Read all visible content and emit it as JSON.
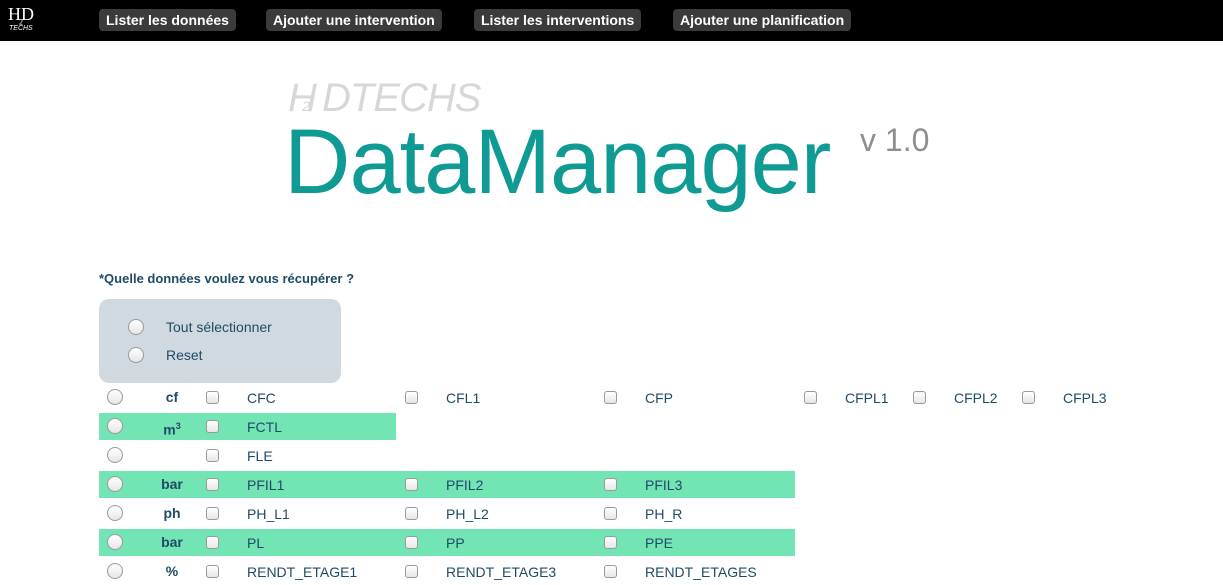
{
  "nav": {
    "brand_h": "H",
    "brand_2": "2",
    "brand_d": "D",
    "brand_techs": "TECHS",
    "buttons": [
      "Lister les données",
      "Ajouter une intervention",
      "Lister les interventions",
      "Ajouter une planification"
    ]
  },
  "logo": {
    "techs_h": "H",
    "techs_2": "2",
    "techs_text": "DTECHS",
    "title": "DataManager",
    "version": "v 1.0"
  },
  "form": {
    "question": "*Quelle données voulez vous récupérer ?",
    "select_all_label": "Tout sélectionner",
    "reset_label": "Reset"
  },
  "rows": [
    {
      "unit": "cf",
      "sup": "",
      "highlight": false,
      "items": [
        "CFC",
        "CFL1",
        "CFP",
        "CFPL1",
        "CFPL2",
        "CFPL3"
      ]
    },
    {
      "unit": "m",
      "sup": "3",
      "highlight": true,
      "items": [
        "FCTL"
      ]
    },
    {
      "unit": "",
      "sup": "",
      "highlight": false,
      "items": [
        "FLE"
      ]
    },
    {
      "unit": "bar",
      "sup": "",
      "highlight": true,
      "items": [
        "PFIL1",
        "PFIL2",
        "PFIL3"
      ]
    },
    {
      "unit": "ph",
      "sup": "",
      "highlight": false,
      "items": [
        "PH_L1",
        "PH_L2",
        "PH_R"
      ]
    },
    {
      "unit": "bar",
      "sup": "",
      "highlight": true,
      "items": [
        "PL",
        "PP",
        "PPE"
      ]
    },
    {
      "unit": "%",
      "sup": "",
      "highlight": false,
      "items": [
        "RENDT_ETAGE1",
        "RENDT_ETAGE3",
        "RENDT_ETAGES"
      ]
    }
  ],
  "colors": {
    "topbar": "#000000",
    "nav_button": "#3b3b3b",
    "accent_teal": "#0f9a94",
    "row_highlight": "#73e4b4",
    "text_navy": "#1e4b66",
    "select_panel": "#cfd9df"
  }
}
